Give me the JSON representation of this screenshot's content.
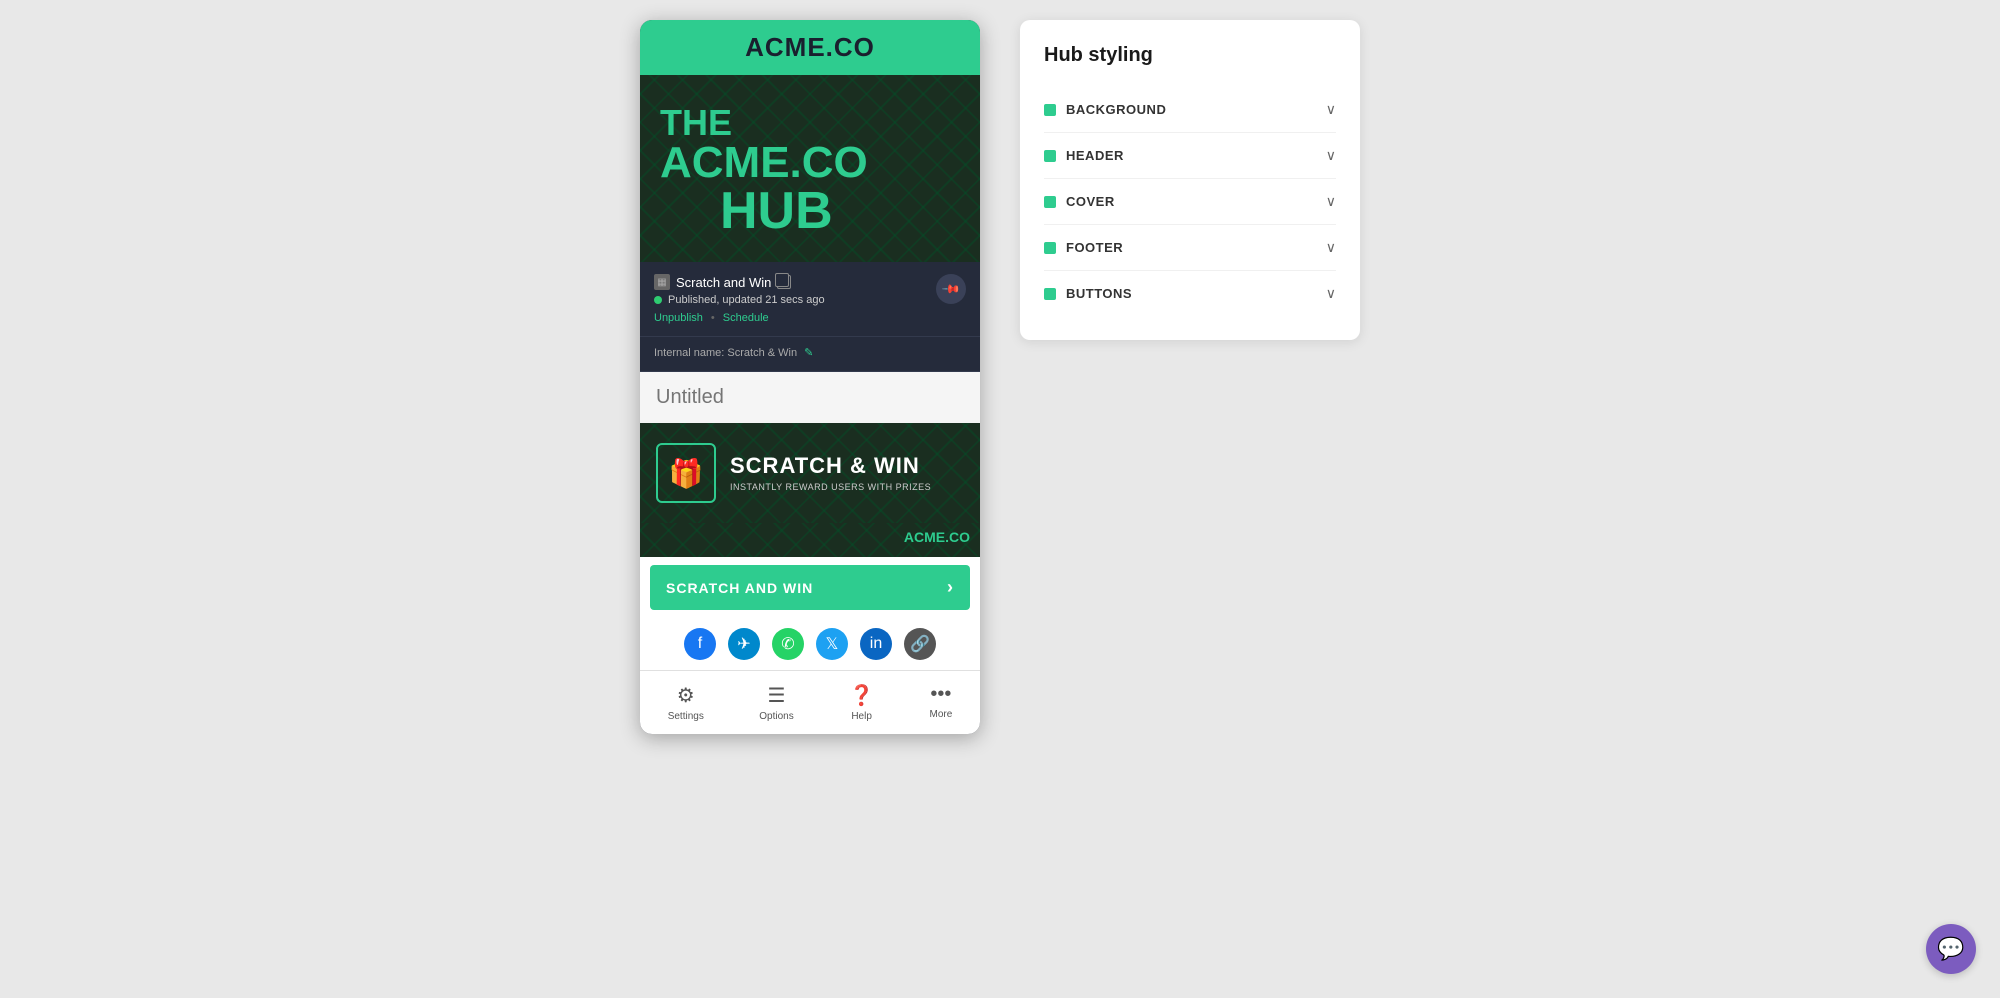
{
  "app": {
    "background_color": "#e8e8e8"
  },
  "phone_preview": {
    "header": {
      "brand": "ACME.",
      "brand_suffix": "CO"
    },
    "hero": {
      "line1": "THE",
      "line2": "ACME.CO",
      "line3": "HUB"
    },
    "card": {
      "icon": "▦",
      "name": "Scratch and Win",
      "status": "Published, updated 21 secs ago",
      "unpublish_label": "Unpublish",
      "schedule_label": "Schedule",
      "internal_name_prefix": "Internal name:",
      "internal_name": "Scratch & Win",
      "pin_title": "Pin"
    },
    "untitled_input": {
      "placeholder": "Untitled"
    },
    "scratch_card": {
      "title": "SCRATCH & WIN",
      "subtitle": "INSTANTLY REWARD USERS WITH PRIZES",
      "footer_logo": "ACME.CO"
    },
    "cta": {
      "label": "SCRATCH AND WIN",
      "arrow": "›"
    },
    "social": {
      "icons": [
        "facebook",
        "telegram",
        "whatsapp",
        "twitter",
        "linkedin",
        "link"
      ]
    },
    "bottom_nav": [
      {
        "icon": "⚙",
        "label": "Settings"
      },
      {
        "icon": "☰",
        "label": "Options"
      },
      {
        "icon": "?",
        "label": "Help"
      },
      {
        "icon": "…",
        "label": "More"
      }
    ]
  },
  "hub_styling": {
    "title": "Hub styling",
    "sections": [
      {
        "label": "BACKGROUND"
      },
      {
        "label": "HEADER"
      },
      {
        "label": "COVER"
      },
      {
        "label": "FOOTER"
      },
      {
        "label": "BUTTONS"
      }
    ]
  },
  "chat_button": {
    "label": "Chat"
  }
}
